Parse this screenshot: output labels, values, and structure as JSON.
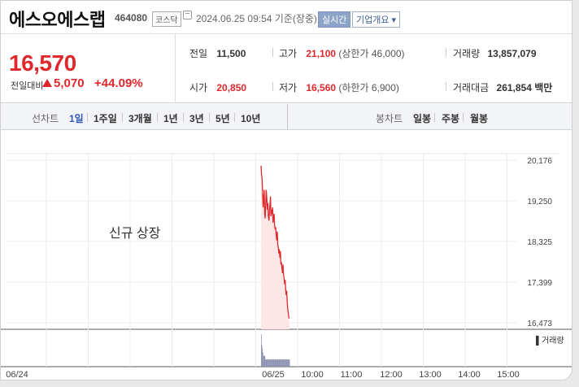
{
  "header": {
    "name": "에스오에스랩",
    "code": "464080",
    "market": "코스닥",
    "datetime": "2024.06.25 09:54",
    "basis": "기준(장중)",
    "realtime_label": "실시간",
    "company_info_label": "기업개요 ▾"
  },
  "quote": {
    "price": "16,570",
    "change_label": "전일대비",
    "change": "5,070",
    "change_pct": "+44.09%",
    "up_color": "#e0282c"
  },
  "stats": {
    "prev_close_label": "전일",
    "prev_close": "11,500",
    "high_label": "고가",
    "high": "21,100",
    "upper_limit": "(상한가 46,000)",
    "volume_label": "거래량",
    "volume": "13,857,079",
    "open_label": "시가",
    "open": "20,850",
    "low_label": "저가",
    "low": "16,560",
    "lower_limit": "(하한가 6,900)",
    "amount_label": "거래대금",
    "amount": "261,854 백만"
  },
  "tabs": {
    "line_chart_label": "선차트",
    "periods": [
      "1일",
      "1주일",
      "3개월",
      "1년",
      "3년",
      "5년",
      "10년"
    ],
    "active_period": "1일",
    "candle_label": "봉차트",
    "candles": [
      "일봉",
      "주봉",
      "월봉"
    ]
  },
  "chart_note": "신규 상장",
  "volume_legend": "▌거래량",
  "chart_data": {
    "type": "area",
    "y_ticks": [
      20176,
      19250,
      18325,
      17399,
      16473
    ],
    "ylim": [
      16473,
      20176
    ],
    "x_ticks": [
      "06/24",
      "06/25",
      "10:00",
      "11:00",
      "12:00",
      "13:00",
      "14:00",
      "15:00"
    ],
    "x": [
      "09:00",
      "09:01",
      "09:02",
      "09:03",
      "09:04",
      "09:05",
      "09:06",
      "09:07",
      "09:08",
      "09:09",
      "09:10",
      "09:11",
      "09:12",
      "09:13",
      "09:14",
      "09:15",
      "09:16",
      "09:17",
      "09:18",
      "09:19",
      "09:20",
      "09:21",
      "09:22",
      "09:23",
      "09:24",
      "09:25",
      "09:26",
      "09:27",
      "09:28",
      "09:29",
      "09:30",
      "09:31",
      "09:32",
      "09:33",
      "09:34",
      "09:35",
      "09:36",
      "09:37",
      "09:38",
      "09:39",
      "09:40",
      "09:41",
      "09:42",
      "09:43",
      "09:44",
      "09:45",
      "09:46",
      "09:47",
      "09:48",
      "09:49",
      "09:50",
      "09:51",
      "09:52",
      "09:53",
      "09:54"
    ],
    "series": [
      {
        "values": [
          20050,
          19850,
          19750,
          19450,
          19100,
          19300,
          19500,
          18950,
          18850,
          19200,
          19500,
          19300,
          19050,
          19200,
          18900,
          18800,
          19000,
          19150,
          19350,
          18900,
          19050,
          18950,
          19100,
          18750,
          18900,
          18950,
          18700,
          18600,
          18650,
          18450,
          18350,
          18550,
          18250,
          18200,
          18050,
          18150,
          17950,
          18100,
          17800,
          17850,
          17700,
          17600,
          17800,
          17550,
          17500,
          17350,
          17450,
          17250,
          17100,
          17200,
          16950,
          16800,
          16700,
          16600,
          16570
        ],
        "color": "#e0282c"
      }
    ],
    "volume": [
      9,
      6,
      5,
      4,
      3,
      3,
      3,
      3,
      2,
      2,
      2,
      2,
      2,
      2,
      2,
      2,
      2,
      2,
      2,
      2,
      2,
      2,
      2,
      2,
      2,
      2,
      2,
      2,
      2,
      2,
      2,
      2,
      2,
      2,
      2,
      2,
      2,
      2,
      2,
      2,
      2,
      2,
      2,
      2,
      2,
      2,
      2,
      2,
      2,
      2,
      2,
      2,
      2,
      2,
      2
    ],
    "volume_color": "#8a8fb0",
    "area_color": "#fde6e6",
    "grid": true
  }
}
